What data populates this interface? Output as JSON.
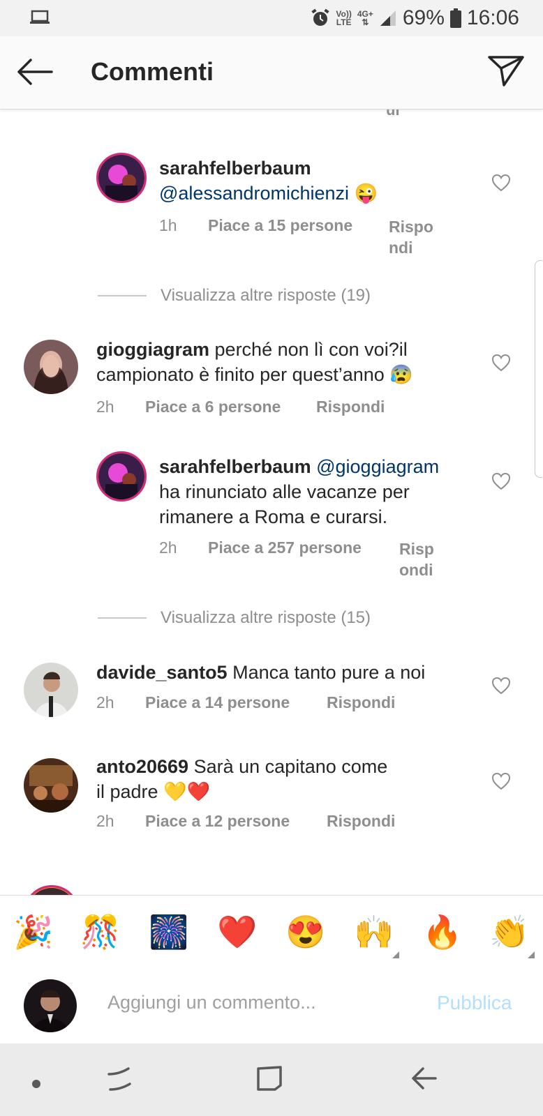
{
  "status_bar": {
    "volte_top": "Vo))",
    "volte_bottom": "LTE",
    "network": "4G+",
    "battery": "69%",
    "time": "16:06"
  },
  "header": {
    "title": "Commenti"
  },
  "list": {
    "clipped_text": "ui",
    "comments": [
      {
        "user": "sarahfelberbaum",
        "mention": "@alessandromichienzi",
        "text": "",
        "emoji": "😜",
        "time": "1h",
        "likes": "Piace a 15 persone",
        "reply_line1": "Rispo",
        "reply_line2": "ndi"
      },
      {
        "more_replies": "Visualizza altre risposte (19)"
      },
      {
        "user": "gioggiagram",
        "text_line1": "perché non lì con voi?il",
        "text_line2": "campionato è finito per quest’anno",
        "emoji": "😰",
        "time": "2h",
        "likes": "Piace a 6 persone",
        "reply": "Rispondi"
      },
      {
        "user": "sarahfelberbaum",
        "mention": "@gioggiagram",
        "text_line1": "ha rinunciato alle vacanze per",
        "text_line2": "rimanere a Roma e curarsi.",
        "time": "2h",
        "likes": "Piace a 257 persone",
        "reply_line1": "Risp",
        "reply_line2": "ondi"
      },
      {
        "more_replies": "Visualizza altre risposte (15)"
      },
      {
        "user": "davide_santo5",
        "text": "Manca tanto pure a noi",
        "time": "2h",
        "likes": "Piace a 14 persone",
        "reply": "Rispondi"
      },
      {
        "user": "anto20669",
        "text_line1": "Sarà un capitano come",
        "text_line2": "il padre",
        "emoji": "💛❤️",
        "time": "2h",
        "likes": "Piace a 12 persone",
        "reply": "Rispondi"
      }
    ]
  },
  "emoji_bar": [
    "🎉",
    "🎊",
    "🎆",
    "❤️",
    "😍",
    "🙌",
    "🔥",
    "👏"
  ],
  "input": {
    "placeholder": "Aggiungi un commento...",
    "post_label": "Pubblica"
  },
  "colors": {
    "mention": "#003569",
    "meta_gray": "#8e8e8e",
    "post_disabled": "#b2dffc"
  }
}
